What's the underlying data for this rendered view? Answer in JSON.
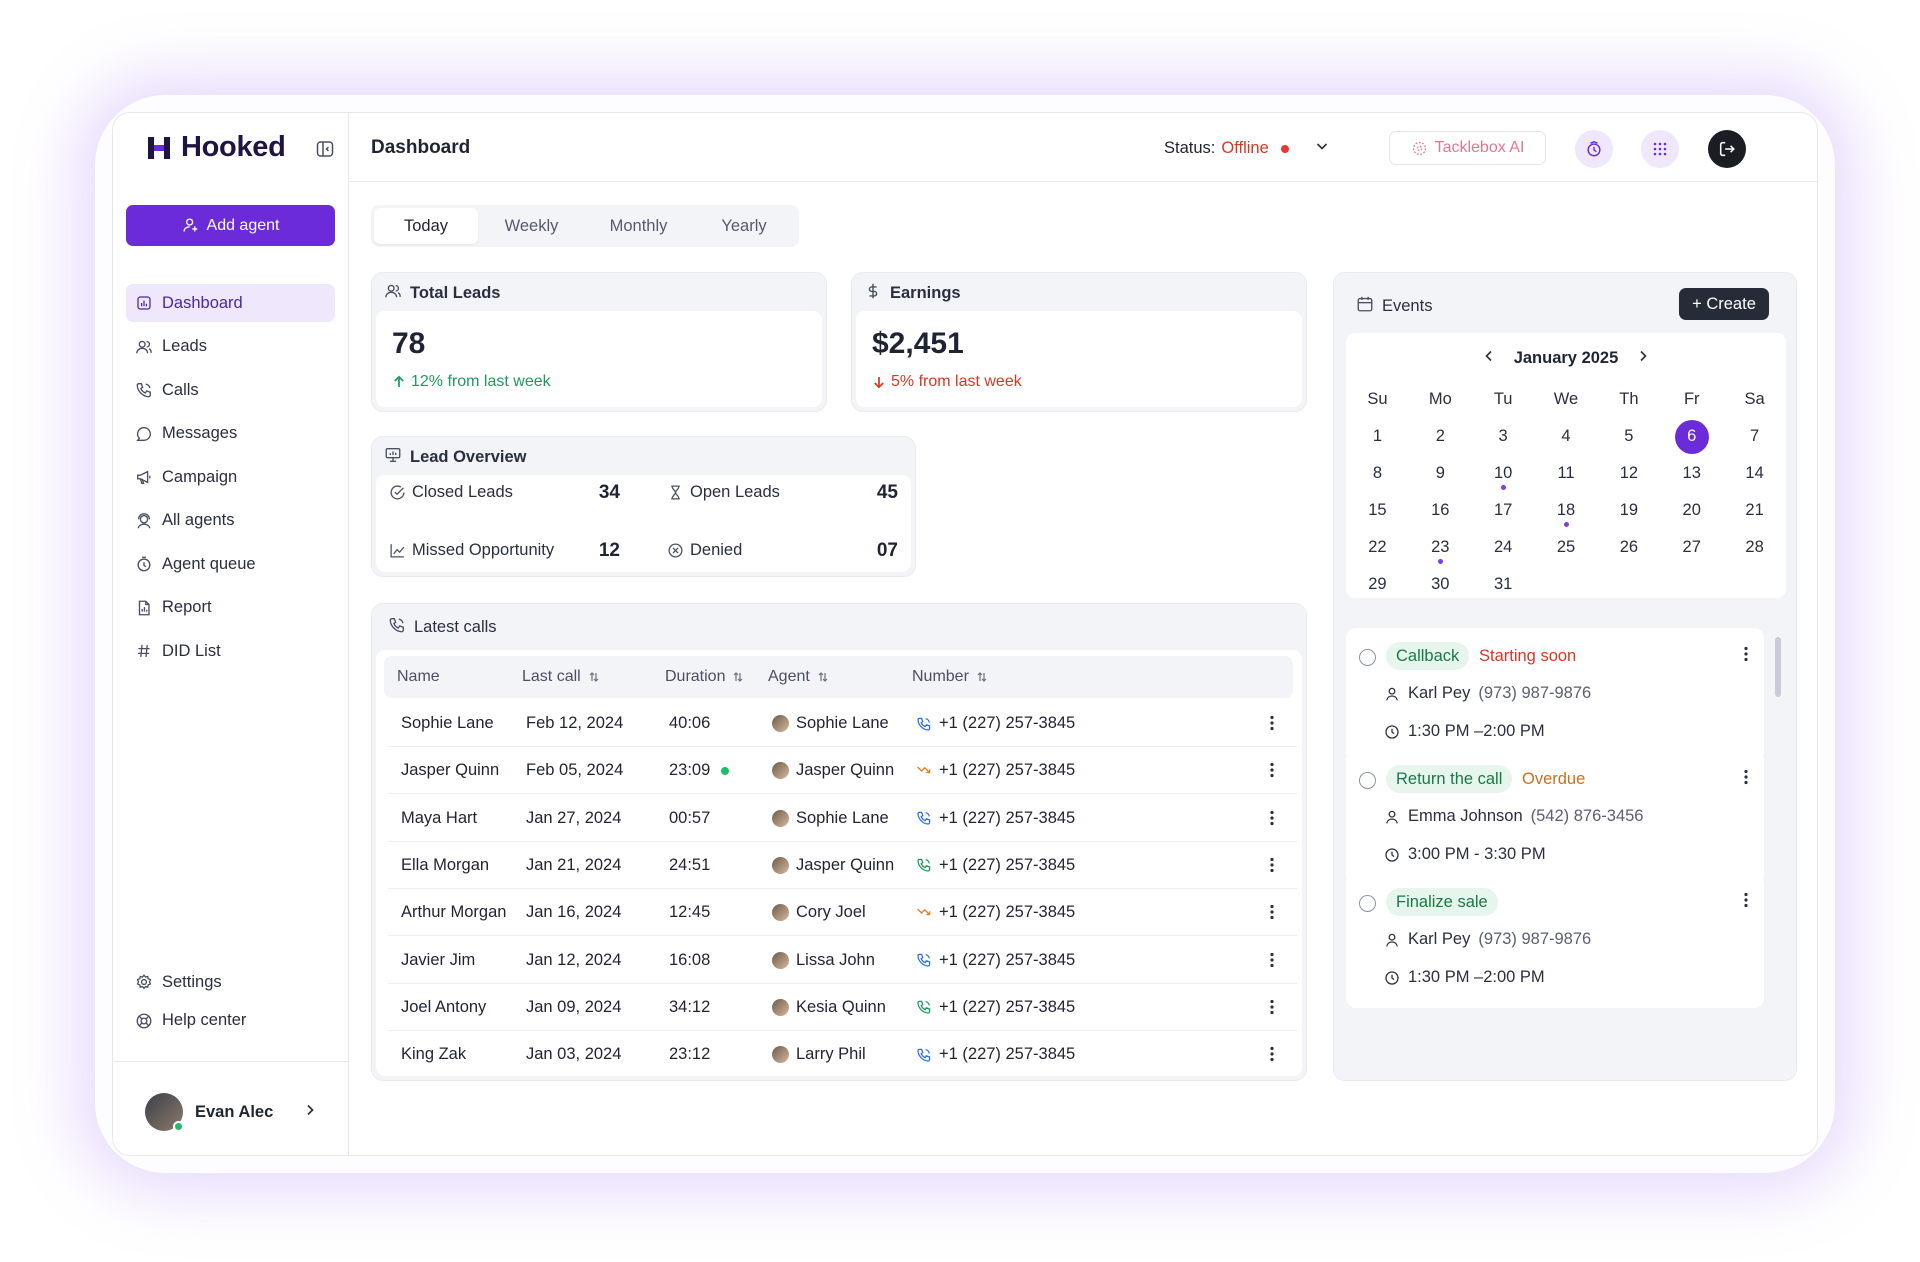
{
  "app": {
    "name": "Hooked",
    "page_title": "Dashboard",
    "brand_color": "#6b2bd9"
  },
  "sidebar": {
    "add_agent": "Add agent",
    "items": [
      {
        "label": "Dashboard",
        "icon": "dashboard-icon",
        "active": true
      },
      {
        "label": "Leads",
        "icon": "users-icon"
      },
      {
        "label": "Calls",
        "icon": "phone-icon"
      },
      {
        "label": "Messages",
        "icon": "message-icon"
      },
      {
        "label": "Campaign",
        "icon": "megaphone-icon"
      },
      {
        "label": "All agents",
        "icon": "agent-icon"
      },
      {
        "label": "Agent queue",
        "icon": "clock-icon"
      },
      {
        "label": "Report",
        "icon": "report-icon"
      },
      {
        "label": "DID List",
        "icon": "hash-icon"
      }
    ],
    "bottom_items": [
      {
        "label": "Settings",
        "icon": "gear-icon"
      },
      {
        "label": "Help center",
        "icon": "help-icon"
      }
    ],
    "user": {
      "name": "Evan Alec"
    }
  },
  "header": {
    "status_label": "Status:",
    "status_value": "Offline",
    "status_color": "#e53935",
    "ai_button": "Tacklebox AI"
  },
  "tabs": [
    "Today",
    "Weekly",
    "Monthly",
    "Yearly"
  ],
  "active_tab": "Today",
  "total_leads": {
    "title": "Total Leads",
    "value": "78",
    "delta": "12% from last week"
  },
  "earnings": {
    "title": "Earnings",
    "value": "$2,451",
    "delta": "5% from last week"
  },
  "lead_overview": {
    "title": "Lead Overview",
    "items": [
      {
        "label": "Closed Leads",
        "value": "34"
      },
      {
        "label": "Open Leads",
        "value": "45"
      },
      {
        "label": "Missed Opportunity",
        "value": "12"
      },
      {
        "label": "Denied",
        "value": "07"
      }
    ]
  },
  "latest_calls": {
    "title": "Latest calls",
    "columns": [
      "Name",
      "Last call",
      "Duration",
      "Agent",
      "Number"
    ],
    "rows": [
      {
        "name": "Sophie Lane",
        "last_call": "Feb 12, 2024",
        "duration": "40:06",
        "agent": "Sophie Lane",
        "number": "+1 (227) 257-3845",
        "call_type": "incoming",
        "live": false
      },
      {
        "name": "Jasper Quinn",
        "last_call": "Feb 05, 2024",
        "duration": "23:09",
        "agent": "Jasper Quinn",
        "number": "+1 (227) 257-3845",
        "call_type": "missed",
        "live": true
      },
      {
        "name": "Maya Hart",
        "last_call": "Jan 27, 2024",
        "duration": "00:57",
        "agent": "Sophie Lane",
        "number": "+1 (227) 257-3845",
        "call_type": "incoming",
        "live": false
      },
      {
        "name": "Ella Morgan",
        "last_call": "Jan 21, 2024",
        "duration": "24:51",
        "agent": "Jasper Quinn",
        "number": "+1 (227) 257-3845",
        "call_type": "outgoing",
        "live": false
      },
      {
        "name": "Arthur Morgan",
        "last_call": "Jan 16, 2024",
        "duration": "12:45",
        "agent": "Cory Joel",
        "number": "+1 (227) 257-3845",
        "call_type": "missed",
        "live": false
      },
      {
        "name": "Javier Jim",
        "last_call": "Jan 12, 2024",
        "duration": "16:08",
        "agent": "Lissa John",
        "number": "+1 (227) 257-3845",
        "call_type": "incoming",
        "live": false
      },
      {
        "name": "Joel Antony",
        "last_call": "Jan 09, 2024",
        "duration": "34:12",
        "agent": "Kesia Quinn",
        "number": "+1 (227) 257-3845",
        "call_type": "outgoing",
        "live": false
      },
      {
        "name": "King Zak",
        "last_call": "Jan 03, 2024",
        "duration": "23:12",
        "agent": "Larry Phil",
        "number": "+1 (227) 257-3845",
        "call_type": "incoming",
        "live": false
      }
    ]
  },
  "events": {
    "title": "Events",
    "create_label": "+ Create",
    "calendar": {
      "month": "January 2025",
      "weekdays": [
        "Su",
        "Mo",
        "Tu",
        "We",
        "Th",
        "Fr",
        "Sa"
      ],
      "weeks": [
        [
          "1",
          "2",
          "3",
          "4",
          "5",
          "6",
          "7"
        ],
        [
          "8",
          "9",
          "10",
          "11",
          "12",
          "13",
          "14"
        ],
        [
          "15",
          "16",
          "17",
          "18",
          "19",
          "20",
          "21"
        ],
        [
          "22",
          "23",
          "24",
          "25",
          "26",
          "27",
          "28"
        ],
        [
          "29",
          "30",
          "31",
          "",
          "",
          "",
          ""
        ]
      ],
      "selected": "6",
      "event_days": [
        "10",
        "18",
        "23"
      ]
    },
    "list": [
      {
        "tag": "Callback",
        "state": "Starting soon",
        "state_color": "#d23a25",
        "contact": "Karl Pey",
        "phone": "(973) 987-9876",
        "time": "1:30 PM –2:00 PM"
      },
      {
        "tag": "Return the call",
        "state": "Overdue",
        "state_color": "#c7731c",
        "contact": "Emma Johnson",
        "phone": "(542) 876-3456",
        "time": "3:00 PM - 3:30 PM"
      },
      {
        "tag": "Finalize sale",
        "state": "",
        "state_color": "#1d9a5c",
        "contact": "Karl Pey",
        "phone": "(973) 987-9876",
        "time": "1:30 PM –2:00 PM"
      }
    ]
  }
}
